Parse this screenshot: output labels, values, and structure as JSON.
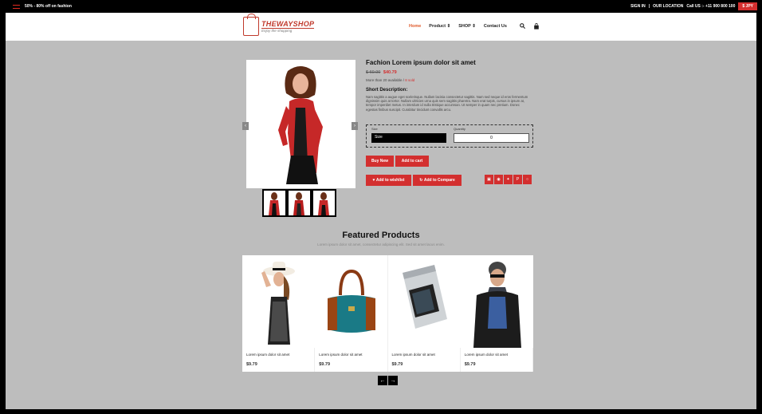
{
  "topbar": {
    "promo": "50% - 80% off on fashion",
    "sign_in": "SIGN IN",
    "separator": "|",
    "location": "OUR LOCATION",
    "call": "Call US :- +11 900 800 100",
    "currency": "$ JPY"
  },
  "logo": {
    "name": "THEWAYSHOP",
    "tagline": "Enjoy the shopping"
  },
  "nav": {
    "items": [
      "Home",
      "Product",
      "SHOP",
      "Contact Us"
    ],
    "dropdown_glyph": "⇕",
    "search_icon": "search-icon",
    "cart_icon": "bag-icon"
  },
  "product": {
    "title": "Fachion Lorem ipsum dolor sit amet",
    "old_price": "$ 60.00",
    "new_price": "$40.79",
    "availability": "More than 20 available",
    "sold": "8 sold",
    "short_desc_title": "Short Description:",
    "short_desc": "Nam sagittis a augue eget scelerisque. Nullam lacinia consectetur sagittis. Nam sed neque id eros fermentum dignissim quis at tortor. Nullam ultricies urna quis sem sagittis pharetra. Nam erat turpis, cursus in ipsum at, tempor imperdiet metus. In interdum id nulla tristique accumsan. Ut semper in quam nec pretium. Donec egestas finibus suscipit. Curabitur tincidunt convallis arcu.",
    "size_label": "Size",
    "size_value": "Size",
    "quantity_label": "Quantity",
    "quantity_value": "0",
    "buy_now": "Buy New",
    "add_to_cart": "Add to cart",
    "wishlist": "Add to wishlist",
    "compare": "Add to Compare",
    "arrow_left": "‹",
    "arrow_right": "›",
    "wishlist_glyph": "♥",
    "compare_glyph": "↻",
    "social": [
      {
        "icon": "share-icon",
        "glyph": "▣"
      },
      {
        "icon": "google-icon",
        "glyph": "◉"
      },
      {
        "icon": "twitter-icon",
        "glyph": "✦"
      },
      {
        "icon": "pinterest-icon",
        "glyph": "P"
      },
      {
        "icon": "whatsapp-icon",
        "glyph": "○"
      }
    ]
  },
  "featured": {
    "title": "Featured Products",
    "subtitle": "Lorem ipsum dolor sit amet, consectetur adipiscing elit. Sed sit amet lacus enim.",
    "items": [
      {
        "name": "Lorem ipsum dolor sit amet",
        "price": "$9.79"
      },
      {
        "name": "Lorem ipsum dolor sit amet",
        "price": "$9.79"
      },
      {
        "name": "Lorem ipsum dolor sit amet",
        "price": "$9.79"
      },
      {
        "name": "Lorem ipsum dolor sit amet",
        "price": "$9.79"
      }
    ],
    "prev": "←",
    "next": "→"
  },
  "colors": {
    "accent": "#d32f2f",
    "background": "#bdbdbd",
    "topbar": "#000000"
  }
}
